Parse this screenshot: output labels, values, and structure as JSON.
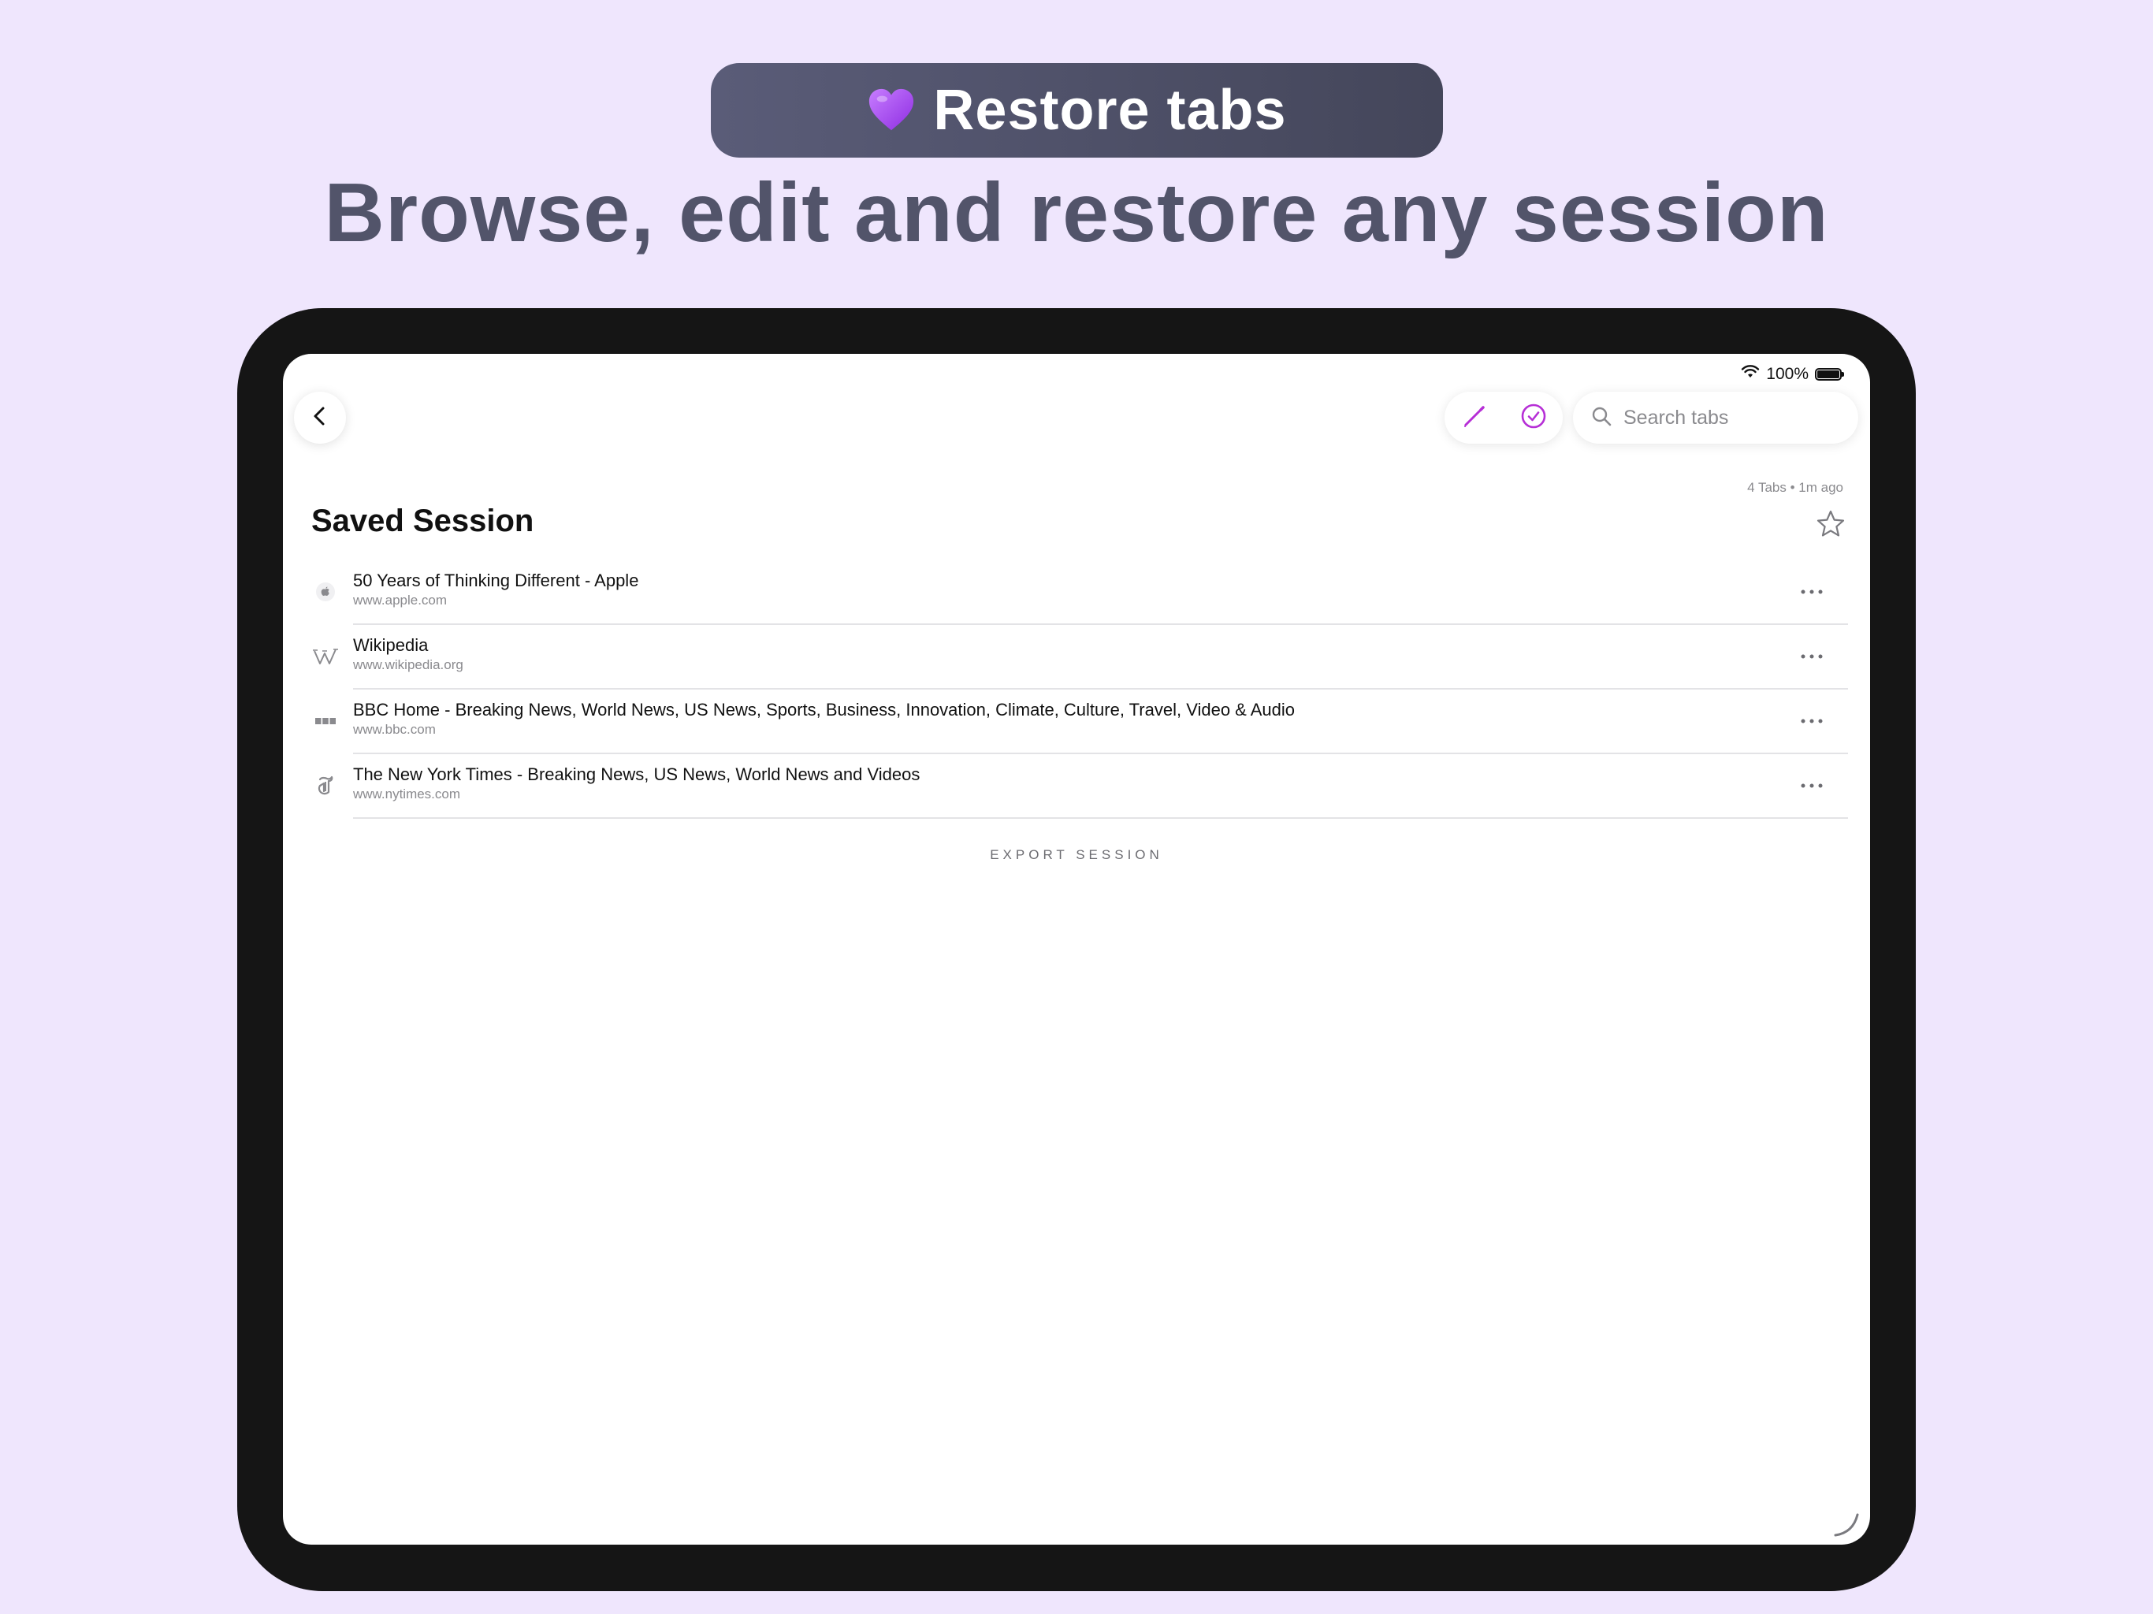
{
  "promo": {
    "badge_icon": "purple-heart-icon",
    "badge_text": "Restore tabs",
    "headline": "Browse, edit and restore any session"
  },
  "colors": {
    "background": "#efe6fd",
    "accent": "#b62fd6",
    "pill_start": "#5a5c78",
    "pill_end": "#44465a",
    "headline": "#52546a",
    "device_frame": "#151515"
  },
  "status_bar": {
    "wifi_icon": "wifi-icon",
    "battery_text": "100%",
    "battery_icon": "battery-icon"
  },
  "toolbar": {
    "back_icon": "chevron-left-icon",
    "edit_icon": "pencil-icon",
    "select_icon": "checkmark-circle-icon",
    "search_icon": "search-icon",
    "search_placeholder": "Search tabs",
    "search_value": ""
  },
  "session": {
    "meta": "4 Tabs • 1m ago",
    "title": "Saved Session",
    "favorite_icon": "star-icon",
    "tabs": [
      {
        "icon": "apple-icon",
        "title": "50 Years of Thinking Different - Apple",
        "url": "www.apple.com"
      },
      {
        "icon": "wikipedia-icon",
        "title": "Wikipedia",
        "url": "www.wikipedia.org"
      },
      {
        "icon": "bbc-icon",
        "title": "BBC Home - Breaking News, World News, US News, Sports, Business, Innovation, Climate, Culture, Travel, Video & Audio",
        "url": "www.bbc.com"
      },
      {
        "icon": "nytimes-icon",
        "title": "The New York Times - Breaking News, US News, World News and Videos",
        "url": "www.nytimes.com"
      }
    ],
    "row_more_icon": "ellipsis-icon",
    "export_label": "EXPORT SESSION"
  }
}
